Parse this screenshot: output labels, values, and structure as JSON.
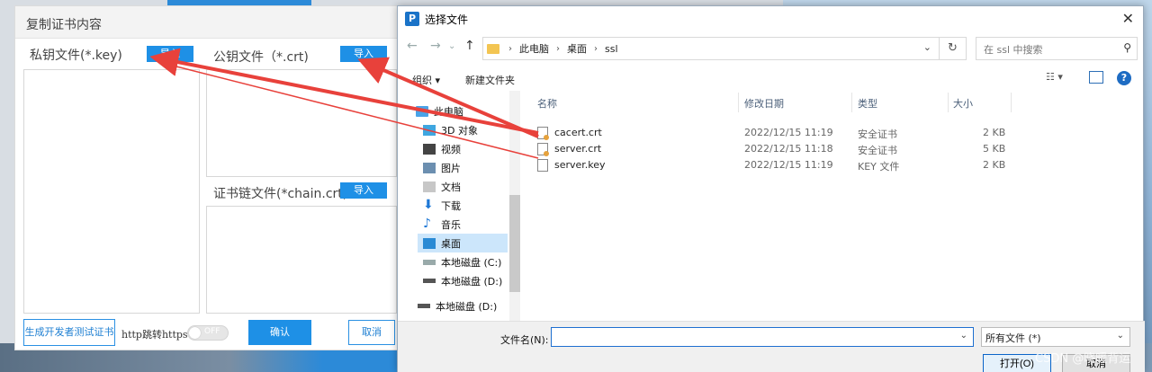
{
  "left_dialog": {
    "title": "复制证书内容",
    "private_key_label": "私钥文件(*.key)",
    "public_key_label": "公钥文件（*.crt)",
    "chain_label": "证书链文件(*chain.crt)",
    "import_label": "导入",
    "generate_button": "生成开发者测试证书",
    "http_redirect_label": "http跳转https",
    "toggle_state": "OFF",
    "confirm_button": "确认",
    "cancel_button": "取消"
  },
  "file_dialog": {
    "title": "选择文件",
    "app_icon_letter": "P",
    "breadcrumb": [
      "此电脑",
      "桌面",
      "ssl"
    ],
    "search_placeholder": "在 ssl 中搜索",
    "organize": "组织 ▾",
    "new_folder": "新建文件夹",
    "sidebar": [
      {
        "label": "此电脑",
        "icon": "computer-icon"
      },
      {
        "label": "3D 对象",
        "icon": "cube-icon"
      },
      {
        "label": "视频",
        "icon": "video-icon"
      },
      {
        "label": "图片",
        "icon": "picture-icon"
      },
      {
        "label": "文档",
        "icon": "document-icon"
      },
      {
        "label": "下载",
        "icon": "download-icon"
      },
      {
        "label": "音乐",
        "icon": "music-icon"
      },
      {
        "label": "桌面",
        "icon": "desktop-icon",
        "selected": true
      },
      {
        "label": "本地磁盘 (C:)",
        "icon": "drive-icon"
      },
      {
        "label": "本地磁盘 (D:)",
        "icon": "drive-icon"
      },
      {
        "label": "本地磁盘 (D:)",
        "icon": "drive-icon"
      }
    ],
    "columns": [
      "名称",
      "修改日期",
      "类型",
      "大小"
    ],
    "files": [
      {
        "name": "cacert.crt",
        "date": "2022/12/15 11:19",
        "type": "安全证书",
        "size": "2 KB"
      },
      {
        "name": "server.crt",
        "date": "2022/12/15 11:18",
        "type": "安全证书",
        "size": "5 KB"
      },
      {
        "name": "server.key",
        "date": "2022/12/15 11:19",
        "type": "KEY 文件",
        "size": "2 KB"
      }
    ],
    "filename_label": "文件名(N):",
    "filename_value": "",
    "filetype_value": "所有文件  (*)",
    "open_button": "打开(O)",
    "cancel_button": "取消"
  },
  "watermark": "CSDN @晓暖背运",
  "colors": {
    "accent": "#1e90e6",
    "arrow": "#e8413b"
  }
}
